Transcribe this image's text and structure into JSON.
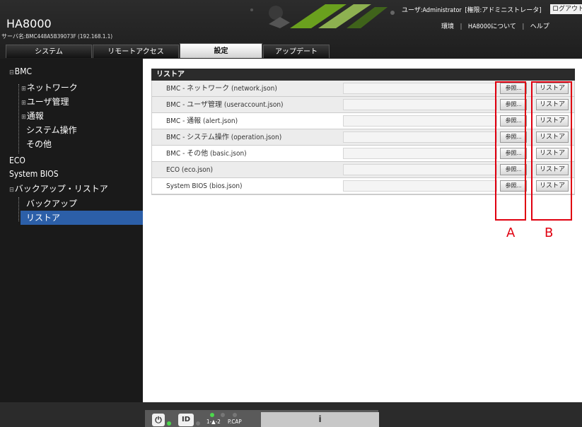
{
  "app": {
    "title": "HA8000",
    "server_name": "サーバ名:BMC448A5B39073F (192.168.1.1)"
  },
  "user": {
    "label": "ユーザ:Administrator",
    "role": "[権限:アドミニストレータ]",
    "logout": "ログアウト"
  },
  "links": {
    "env": "環境",
    "about": "HA8000について",
    "help": "ヘルプ"
  },
  "tabs": [
    {
      "label": "システム",
      "active": false
    },
    {
      "label": "リモートアクセス",
      "active": false
    },
    {
      "label": "設定",
      "active": true
    },
    {
      "label": "アップデート",
      "active": false
    }
  ],
  "sidebar": {
    "items": [
      {
        "label": "BMC",
        "expander": "⊟",
        "level": 0
      },
      {
        "label": "ネットワーク",
        "expander": "⊞",
        "level": 1
      },
      {
        "label": "ユーザ管理",
        "expander": "⊞",
        "level": 1
      },
      {
        "label": "通報",
        "expander": "⊞",
        "level": 1
      },
      {
        "label": "システム操作",
        "expander": "",
        "level": 1
      },
      {
        "label": "その他",
        "expander": "",
        "level": 1
      },
      {
        "label": "ECO",
        "expander": "",
        "level": 0
      },
      {
        "label": "System BIOS",
        "expander": "",
        "level": 0
      },
      {
        "label": "バックアップ・リストア",
        "expander": "⊟",
        "level": 0
      },
      {
        "label": "バックアップ",
        "expander": "",
        "level": 1
      },
      {
        "label": "リストア",
        "expander": "",
        "level": 1,
        "selected": true
      }
    ]
  },
  "restore": {
    "header": "リストア",
    "browse_label": "参照...",
    "restore_label": "リストア",
    "rows": [
      {
        "label": "BMC - ネットワーク (network.json)"
      },
      {
        "label": "BMC - ユーザ管理 (useraccount.json)"
      },
      {
        "label": "BMC - 通報 (alert.json)"
      },
      {
        "label": "BMC - システム操作 (operation.json)"
      },
      {
        "label": "BMC - その他 (basic.json)"
      },
      {
        "label": "ECO (eco.json)"
      },
      {
        "label": "System BIOS (bios.json)"
      }
    ]
  },
  "annotations": {
    "a": "A",
    "b": "B",
    "color": "#e00010"
  },
  "status": {
    "power_icon": "power-icon",
    "id_label": "ID",
    "led_label": "1-▲-2",
    "pcap_label": "P.CAP",
    "info_label": "i"
  },
  "colors": {
    "header_bg": "#1e1e1e",
    "selected_bg": "#2c5fa8",
    "led_green": "#4cd84c"
  }
}
